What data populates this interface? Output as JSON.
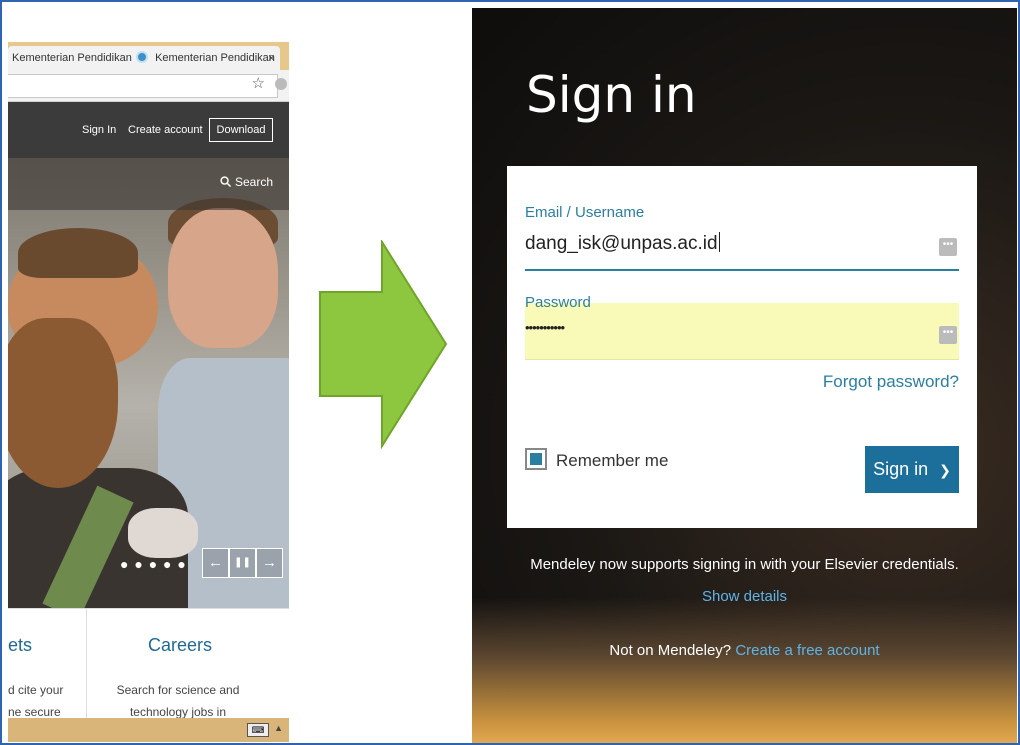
{
  "browser": {
    "tabs": [
      {
        "label": "Kementerian Pendidikan",
        "close": "×"
      },
      {
        "label": "Kementerian Pendidikan",
        "close": "×"
      }
    ],
    "star_icon": "☆",
    "nav": {
      "sign_in": "Sign In",
      "create_account": "Create account",
      "download": "Download"
    },
    "search": "Search",
    "carousel": {
      "dots": "● ● ● ● ●",
      "prev": "←",
      "pause": "❚❚",
      "next": "→"
    },
    "cards": [
      {
        "title": "ets",
        "text_line1": "d cite your",
        "text_line2": "ne secure"
      },
      {
        "title": "Careers",
        "text_line1": "Search for science and",
        "text_line2": "technology jobs in"
      }
    ],
    "taskbar": {
      "keyboard_icon": "⌨",
      "up_icon": "▲"
    }
  },
  "signin": {
    "title": "Sign in",
    "email_label": "Email / Username",
    "email_value": "dang_isk@unpas.ac.id",
    "password_label": "Password",
    "password_value": "•••••••••••",
    "field_menu_icon": "•••",
    "forgot_password": "Forgot password?",
    "remember_me": "Remember me",
    "sign_in_button": "Sign in",
    "sign_in_chevron": "❯",
    "mendeley_note": "Mendeley now supports signing in with your Elsevier credentials.",
    "show_details": "Show details",
    "not_on_mendeley": "Not on Mendeley?",
    "create_free_account": "Create a free account"
  },
  "colors": {
    "arrow": "#8dc63f",
    "accent": "#1c6f9a",
    "link": "#2a7fa0",
    "frame": "#2f64b1"
  }
}
